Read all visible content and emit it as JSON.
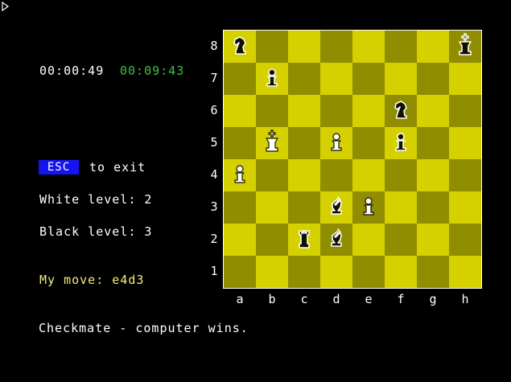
{
  "clocks": {
    "white_time": "00:00:49",
    "black_time": "00:09:43"
  },
  "controls": {
    "esc_label": "ESC",
    "exit_text": "to exit"
  },
  "levels": {
    "white_level": "White level: 2",
    "black_level": "Black level: 3"
  },
  "last_move": "My move: e4d3",
  "status": "Checkmate - computer wins.",
  "board": {
    "ranks": [
      "8",
      "7",
      "6",
      "5",
      "4",
      "3",
      "2",
      "1"
    ],
    "files": [
      "a",
      "b",
      "c",
      "d",
      "e",
      "f",
      "g",
      "h"
    ],
    "pieces": [
      {
        "square": "a8",
        "color": "black",
        "type": "knight"
      },
      {
        "square": "h8",
        "color": "black",
        "type": "king"
      },
      {
        "square": "b7",
        "color": "black",
        "type": "pawn"
      },
      {
        "square": "f6",
        "color": "black",
        "type": "knight"
      },
      {
        "square": "b5",
        "color": "white",
        "type": "king"
      },
      {
        "square": "d5",
        "color": "white",
        "type": "pawn"
      },
      {
        "square": "f5",
        "color": "black",
        "type": "pawn"
      },
      {
        "square": "a4",
        "color": "white",
        "type": "pawn"
      },
      {
        "square": "d3",
        "color": "black",
        "type": "bishop"
      },
      {
        "square": "e3",
        "color": "white",
        "type": "pawn"
      },
      {
        "square": "c2",
        "color": "black",
        "type": "rook"
      },
      {
        "square": "d2",
        "color": "black",
        "type": "bishop"
      }
    ]
  },
  "colors": {
    "light_square": "#d5d000",
    "dark_square": "#908d00",
    "black_clock": "#3ec23e",
    "move_text": "#f2ef78",
    "esc_bg": "#1414f0"
  }
}
